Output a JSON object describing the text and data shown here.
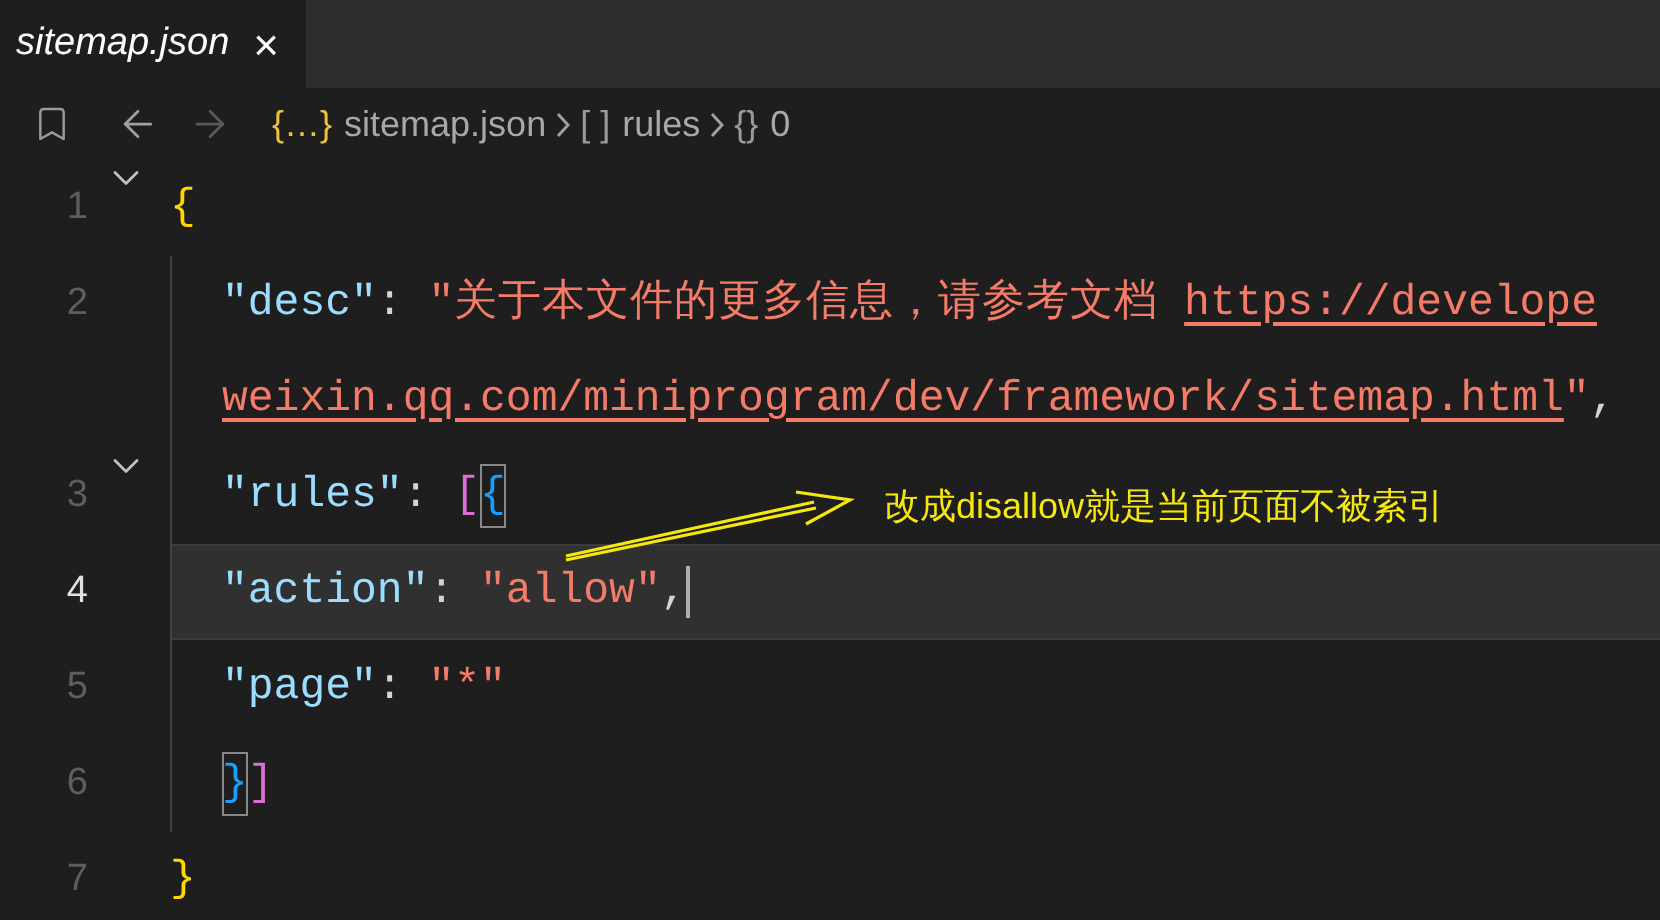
{
  "tab": {
    "title": "sitemap.json",
    "close": "×"
  },
  "breadcrumbs": [
    {
      "icon": "{…}",
      "label": "sitemap.json",
      "kind": "file"
    },
    {
      "icon": "[ ]",
      "label": "rules",
      "kind": "array"
    },
    {
      "icon": "{}",
      "label": "0",
      "kind": "object"
    }
  ],
  "lines": [
    {
      "number": "1",
      "fold": true,
      "current": false,
      "indented": false,
      "rows": [
        {
          "tokens": [
            {
              "text": "{",
              "kind": "bracket",
              "color": "#ffd700",
              "matched": false
            }
          ]
        }
      ]
    },
    {
      "number": "2",
      "fold": false,
      "current": false,
      "indented": true,
      "rows": [
        {
          "tokens": [
            {
              "text": "\"desc\"",
              "kind": "key"
            },
            {
              "text": ": ",
              "kind": "punct"
            },
            {
              "text": "\"关于本文件的更多信息，请参考文档 ",
              "kind": "string"
            },
            {
              "text": "https://develope",
              "kind": "link"
            }
          ]
        },
        {
          "tokens": [
            {
              "text": "weixin.qq.com/miniprogram/dev/framework/sitemap.html",
              "kind": "link"
            },
            {
              "text": "\"",
              "kind": "string"
            },
            {
              "text": ",",
              "kind": "punct"
            }
          ]
        }
      ]
    },
    {
      "number": "3",
      "fold": true,
      "current": false,
      "indented": true,
      "rows": [
        {
          "tokens": [
            {
              "text": "\"rules\"",
              "kind": "key"
            },
            {
              "text": ": ",
              "kind": "punct"
            },
            {
              "text": "[",
              "kind": "bracket",
              "color": "#da70d6",
              "matched": false
            },
            {
              "text": "{",
              "kind": "bracket",
              "color": "#179fff",
              "matched": true
            }
          ]
        }
      ]
    },
    {
      "number": "4",
      "fold": false,
      "current": true,
      "indented": true,
      "rows": [
        {
          "tokens": [
            {
              "text": "\"action\"",
              "kind": "key"
            },
            {
              "text": ": ",
              "kind": "punct"
            },
            {
              "text": "\"allow\"",
              "kind": "string"
            },
            {
              "text": ",",
              "kind": "punct"
            }
          ]
        }
      ]
    },
    {
      "number": "5",
      "fold": false,
      "current": false,
      "indented": true,
      "rows": [
        {
          "tokens": [
            {
              "text": "\"page\"",
              "kind": "key"
            },
            {
              "text": ": ",
              "kind": "punct"
            },
            {
              "text": "\"*\"",
              "kind": "string"
            }
          ]
        }
      ]
    },
    {
      "number": "6",
      "fold": false,
      "current": false,
      "indented": true,
      "rows": [
        {
          "tokens": [
            {
              "text": "}",
              "kind": "bracket",
              "color": "#179fff",
              "matched": true
            },
            {
              "text": "]",
              "kind": "bracket",
              "color": "#da70d6",
              "matched": false
            }
          ]
        }
      ]
    },
    {
      "number": "7",
      "fold": false,
      "current": false,
      "indented": false,
      "rows": [
        {
          "tokens": [
            {
              "text": "}",
              "kind": "bracket",
              "color": "#ffd700",
              "matched": false
            }
          ]
        }
      ]
    }
  ],
  "annotation": {
    "text": "改成disallow就是当前页面不被索引"
  }
}
